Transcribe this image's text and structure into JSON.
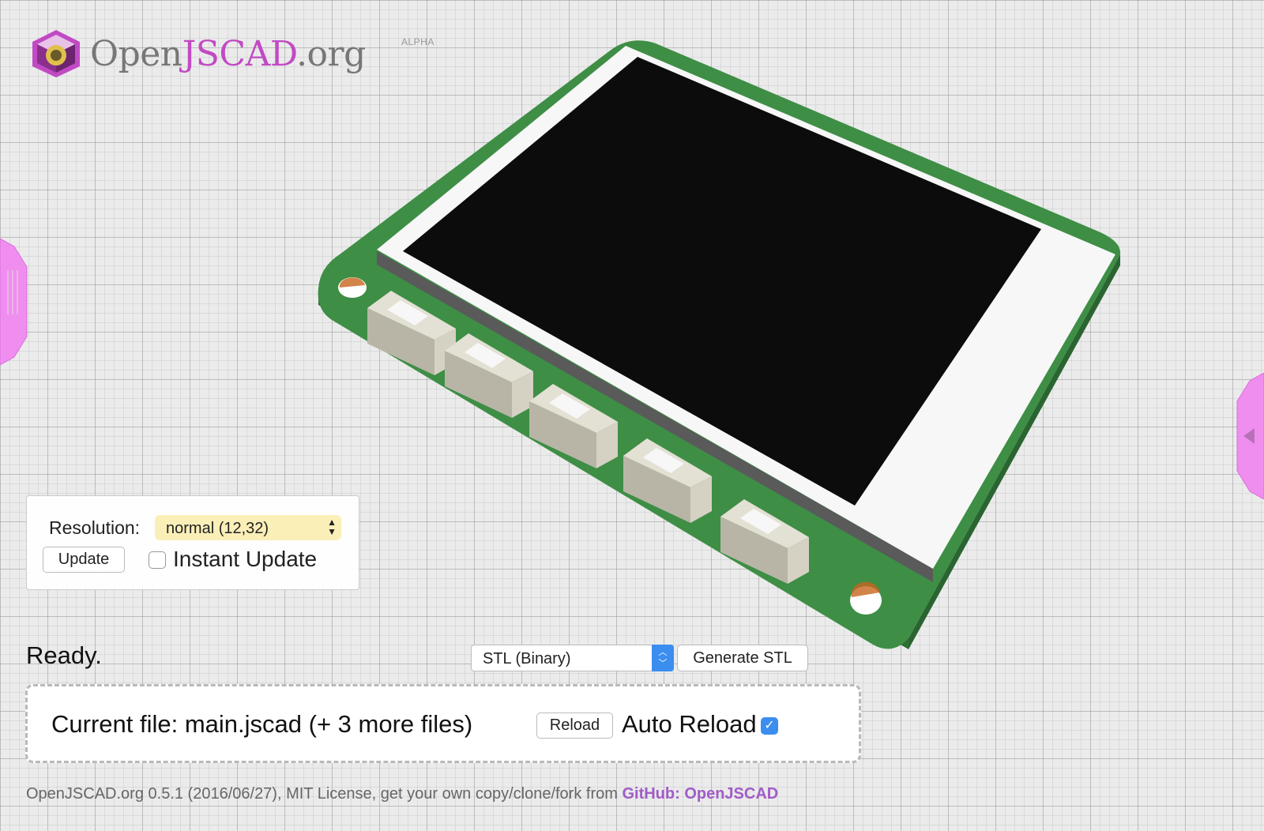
{
  "logo": {
    "text_main": "Open",
    "text_accent": "JSCAD",
    "text_suffix": ".org",
    "badge": "ALPHA",
    "accent_color": "#c14ac4"
  },
  "side_tabs": {
    "left_icon": "grip-icon",
    "right_icon": "collapse-left-arrow-icon",
    "color": "#f08ef0"
  },
  "viewer": {
    "model": "pcb-display-board",
    "board_color": "#3e8e46",
    "screen_color": "#0c0c0c",
    "bezel_color": "#f7f7f7",
    "button_color": "#e3e0d4"
  },
  "params": {
    "resolution_label": "Resolution:",
    "resolution_value": "normal (12,32)",
    "update_label": "Update",
    "instant_update_label": "Instant Update",
    "instant_update_checked": false
  },
  "status": {
    "text": "Ready."
  },
  "export": {
    "format_value": "STL (Binary)",
    "generate_label": "Generate STL"
  },
  "file": {
    "current_label": "Current file: main.jscad (+ 3 more files)",
    "reload_label": "Reload",
    "auto_reload_label": "Auto Reload",
    "auto_reload_checked": true
  },
  "footer": {
    "text": "OpenJSCAD.org 0.5.1 (2016/06/27), MIT License, get your own copy/clone/fork from ",
    "link_text": "GitHub: OpenJSCAD"
  }
}
